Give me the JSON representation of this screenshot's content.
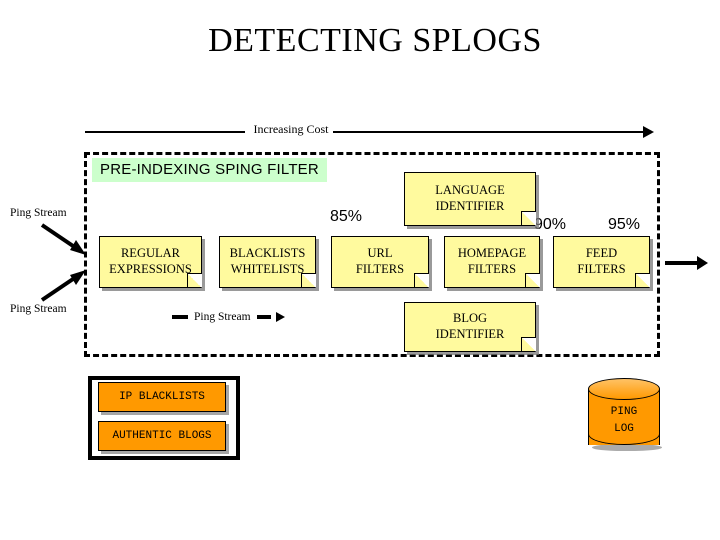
{
  "slide": {
    "title": "DETECTING SPLOGS",
    "background_color": "#ffffff"
  },
  "cost_axis": {
    "label": "Increasing Cost",
    "direction": "left-to-right"
  },
  "pipeline_container": {
    "header": "PRE-INDEXING SPING FILTER",
    "header_bg": "#ccffcc",
    "border_style": "dashed"
  },
  "inputs": [
    {
      "label": "Ping Stream"
    },
    {
      "label": "Ping Stream"
    }
  ],
  "legend": {
    "label": "Ping Stream"
  },
  "stages": [
    {
      "id": "regular-expressions",
      "line1": "REGULAR",
      "line2": "EXPRESSIONS"
    },
    {
      "id": "blacklists-whitelists",
      "line1": "BLACKLISTS",
      "line2": "WHITELISTS"
    },
    {
      "id": "url-filters",
      "line1": "URL",
      "line2": "FILTERS"
    },
    {
      "id": "homepage-filters",
      "line1": "HOMEPAGE",
      "line2": "FILTERS"
    },
    {
      "id": "feed-filters",
      "line1": "FEED",
      "line2": "FILTERS"
    }
  ],
  "identifiers": [
    {
      "id": "language-identifier",
      "line1": "LANGUAGE",
      "line2": "IDENTIFIER"
    },
    {
      "id": "blog-identifier",
      "line1": "BLOG",
      "line2": "IDENTIFIER"
    }
  ],
  "percentages": [
    {
      "value": "85%"
    },
    {
      "value": "90%"
    },
    {
      "value": "95%"
    }
  ],
  "resources": [
    {
      "id": "ip-blacklists",
      "label": "IP BLACKLISTS"
    },
    {
      "id": "authentic-blogs",
      "label": "AUTHENTIC BLOGS"
    }
  ],
  "datastore": {
    "line1": "PING",
    "line2": "LOG",
    "color": "#ff9900"
  },
  "colors": {
    "note_yellow": "#fffa9e",
    "header_green": "#ccffcc",
    "orange": "#ff9900",
    "outline": "#000000"
  }
}
